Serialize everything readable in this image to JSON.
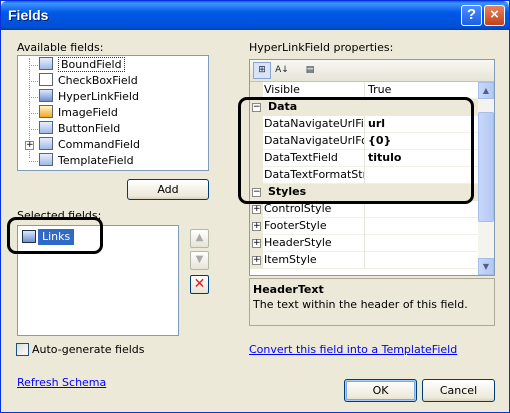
{
  "window": {
    "title": "Fields",
    "help_glyph": "?",
    "close_glyph": "×"
  },
  "available": {
    "label": "Available fields:",
    "items": [
      {
        "label": "BoundField",
        "icon": "bound-field-icon"
      },
      {
        "label": "CheckBoxField",
        "icon": "checkbox-field-icon"
      },
      {
        "label": "HyperLinkField",
        "icon": "hyperlink-field-icon"
      },
      {
        "label": "ImageField",
        "icon": "image-field-icon"
      },
      {
        "label": "ButtonField",
        "icon": "button-field-icon"
      },
      {
        "label": "CommandField",
        "icon": "command-field-icon",
        "expandable": true
      },
      {
        "label": "TemplateField",
        "icon": "template-field-icon"
      }
    ],
    "add_button": "Add"
  },
  "selected": {
    "label": "Selected fields:",
    "items": [
      {
        "label": "Links",
        "icon": "hyperlink-field-icon"
      }
    ],
    "up_glyph": "▲",
    "down_glyph": "▼",
    "delete_glyph": "✕"
  },
  "properties": {
    "label": "HyperLinkField properties:",
    "toolbar": {
      "categorized": "⊞",
      "alphabetical": "A↓",
      "pages": "▤"
    },
    "rows": [
      {
        "name": "Visible",
        "value": "True",
        "type": "prop"
      },
      {
        "name": "Data",
        "type": "category",
        "expander": "−"
      },
      {
        "name": "DataNavigateUrlFiel",
        "value": "url",
        "type": "prop",
        "bold": true
      },
      {
        "name": "DataNavigateUrlFor",
        "value": "{0}",
        "type": "prop",
        "bold": true
      },
      {
        "name": "DataTextField",
        "value": "titulo",
        "type": "prop",
        "bold": true
      },
      {
        "name": "DataTextFormatStri",
        "value": "",
        "type": "prop"
      },
      {
        "name": "Styles",
        "type": "category",
        "expander": "−"
      },
      {
        "name": "ControlStyle",
        "value": "",
        "type": "prop",
        "expander": "+"
      },
      {
        "name": "FooterStyle",
        "value": "",
        "type": "prop",
        "expander": "+"
      },
      {
        "name": "HeaderStyle",
        "value": "",
        "type": "prop",
        "expander": "+"
      },
      {
        "name": "ItemStyle",
        "value": "",
        "type": "prop",
        "expander": "+"
      }
    ],
    "description": {
      "title": "HeaderText",
      "text": "The text within the header of this field."
    }
  },
  "autogen": {
    "label": "Auto-generate fields",
    "checked": false
  },
  "convert_link": "Convert this field into a TemplateField",
  "refresh_link": "Refresh Schema",
  "buttons": {
    "ok": "OK",
    "cancel": "Cancel"
  }
}
